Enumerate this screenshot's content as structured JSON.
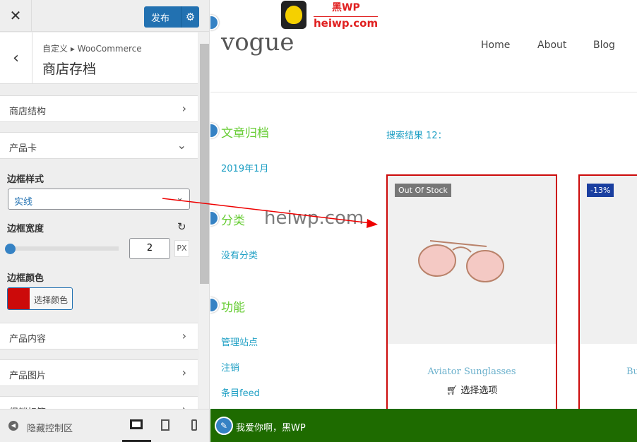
{
  "panel": {
    "close": "✕",
    "publish": "发布",
    "gear": "⚙",
    "back": "‹",
    "breadcrumb": "自定义 ▸ WooCommerce",
    "title": "商店存档",
    "sections": [
      "商店结构",
      "产品卡",
      "产品内容",
      "产品图片",
      "促销标签"
    ],
    "border_style_label": "边框样式",
    "border_style_value": "实线",
    "border_width_label": "边框宽度",
    "border_width_value": "2",
    "unit": "PX",
    "border_color_label": "边框颜色",
    "border_color": "#cc0a0a",
    "choose_color": "选择颜色",
    "hide_controls": "隐藏控制区"
  },
  "preview": {
    "watermark_top": "黑WP",
    "watermark_bottom": "heiwp.com",
    "overlay_text": "heiwp.com",
    "site_title": "vogue",
    "nav": [
      "Home",
      "About",
      "Blog"
    ],
    "widgets": [
      {
        "title": "文章归档",
        "links": [
          "2019年1月"
        ]
      },
      {
        "title": "分类",
        "links": [
          "没有分类"
        ]
      },
      {
        "title": "功能",
        "links": [
          "管理站点",
          "注销",
          "条目feed"
        ]
      }
    ],
    "results": "搜索结果 12：",
    "products": [
      {
        "badge": "Out Of Stock",
        "name": "Aviator Sunglasses",
        "action": "选择选项"
      },
      {
        "badge": "-13%",
        "name": "Bu"
      }
    ],
    "footer_text": "我爱你啊，黑WP"
  }
}
